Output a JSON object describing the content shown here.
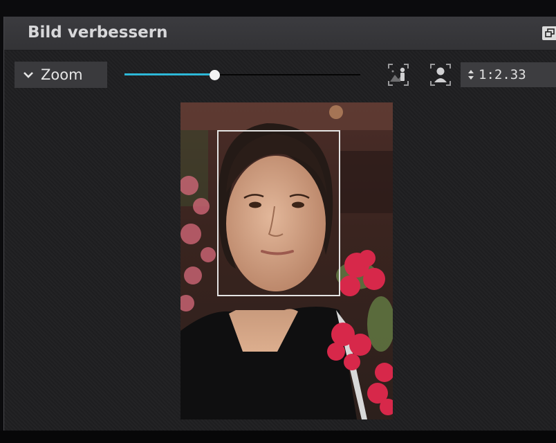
{
  "panel": {
    "title": "Bild verbessern"
  },
  "toolbar": {
    "zoom_label": "Zoom",
    "zoom_value": "1:2.33",
    "zoom_slider_fraction": 0.38
  },
  "image": {
    "description": "portrait photo"
  },
  "colors": {
    "accent": "#2db8d8",
    "panel_bg": "#2a2a2c",
    "title_bar": "#38383b"
  }
}
